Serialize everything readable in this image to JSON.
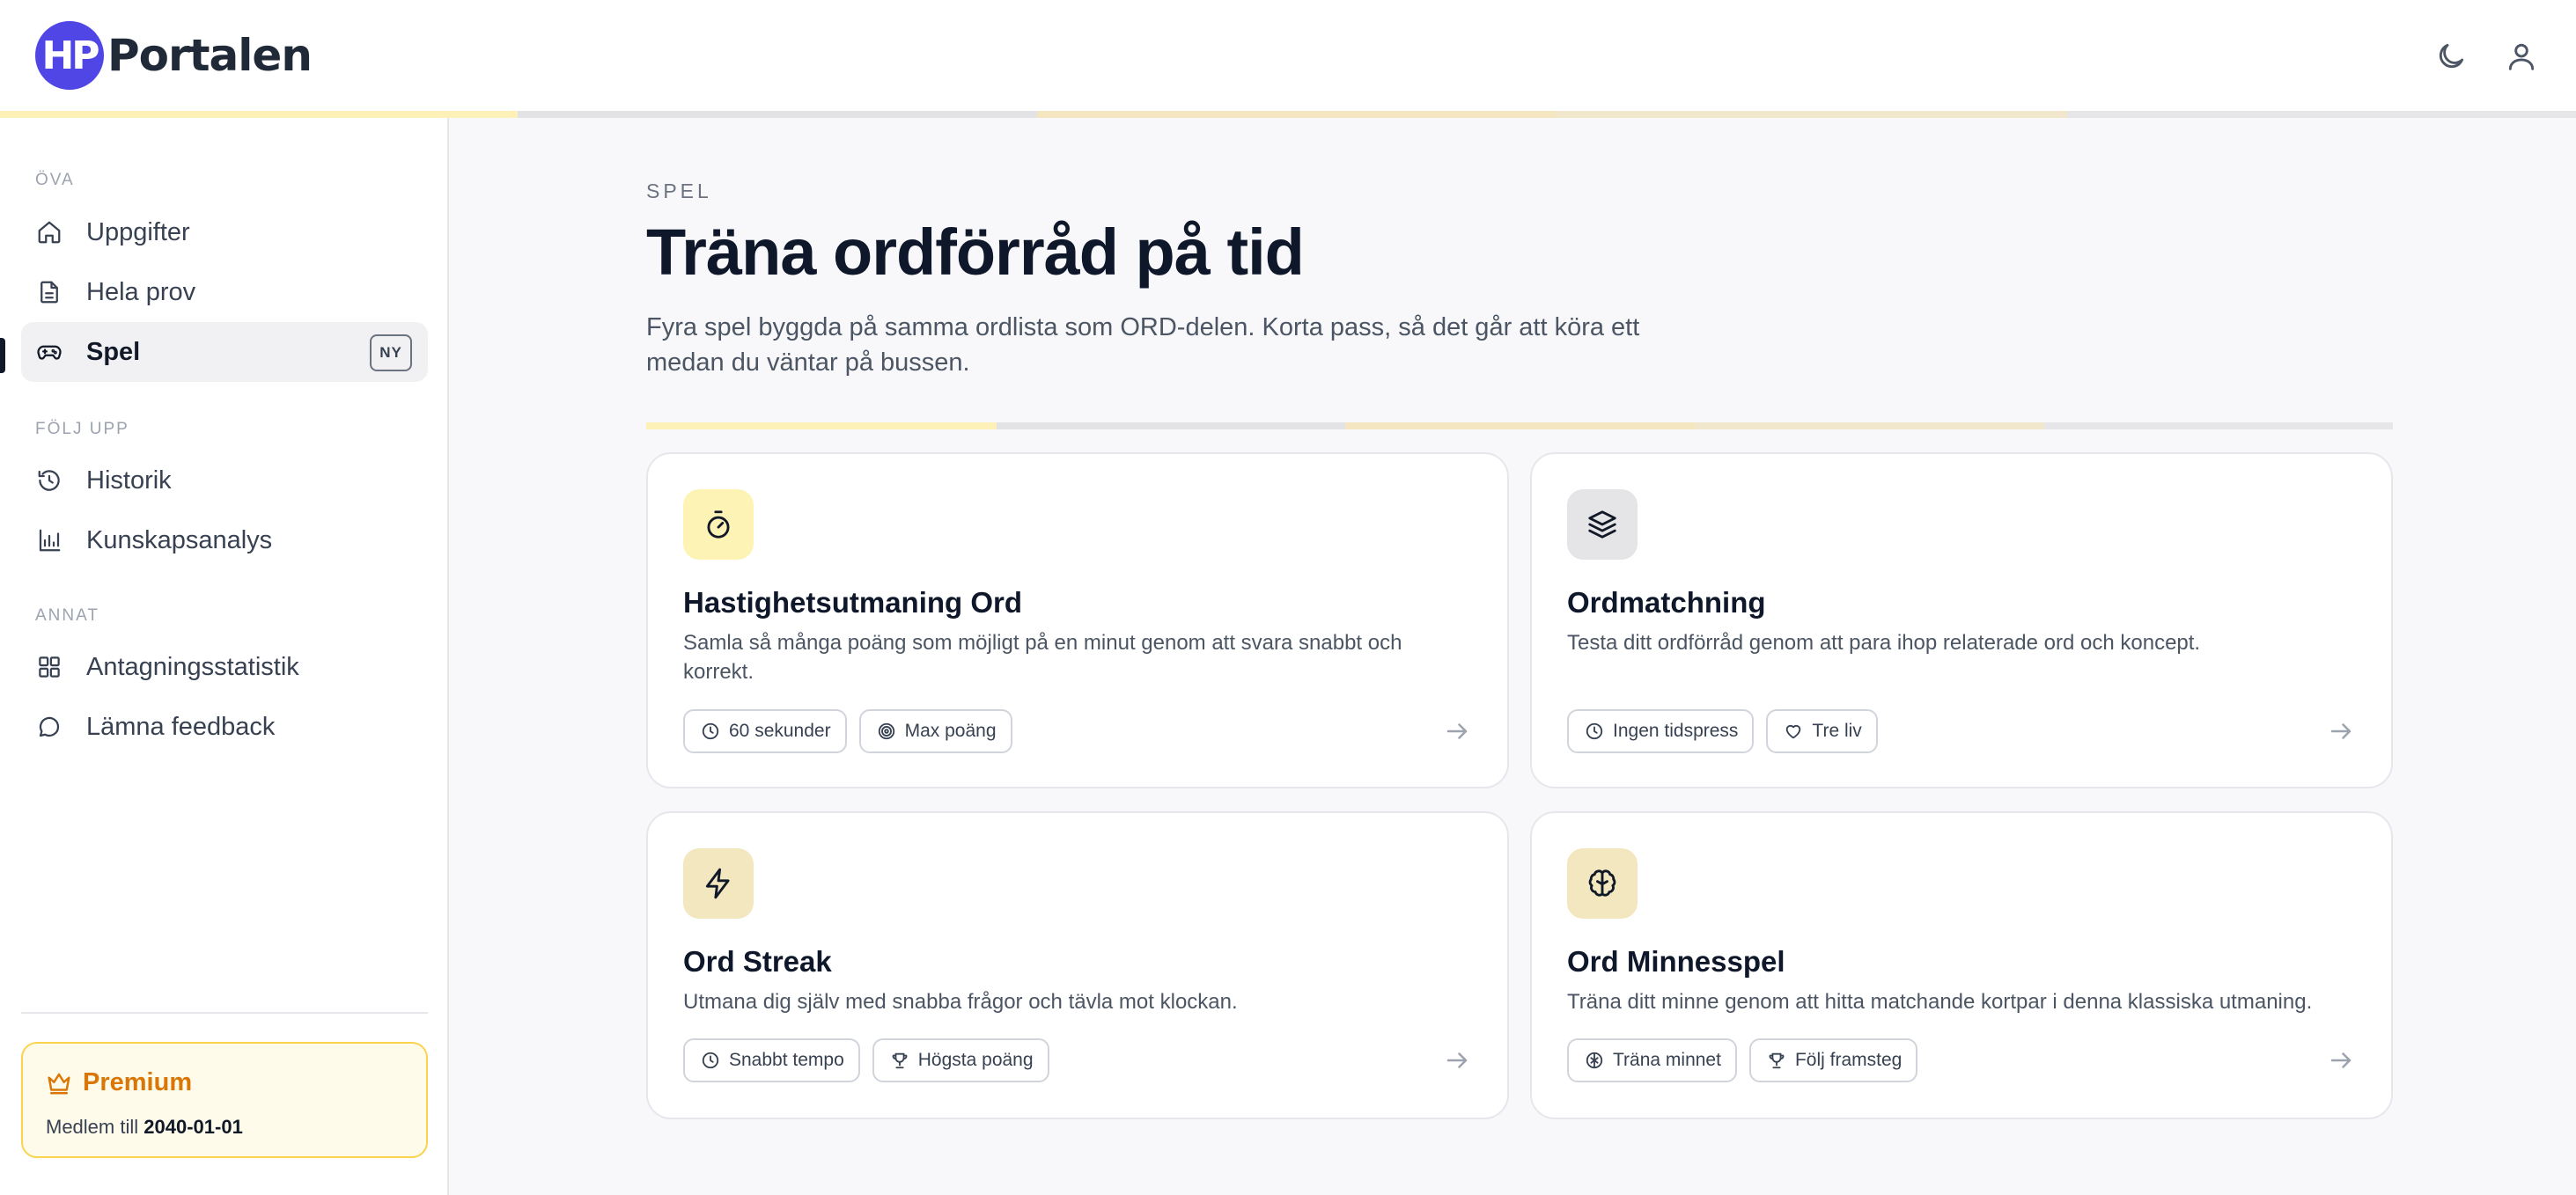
{
  "header": {
    "logo_mark": "HP",
    "logo_text": "Portalen",
    "theme_toggle_icon": "moon-icon",
    "account_icon": "user-icon"
  },
  "sidebar": {
    "sections": [
      {
        "label": "ÖVA"
      },
      {
        "label": "FÖLJ UPP"
      },
      {
        "label": "ANNAT"
      }
    ],
    "items": [
      {
        "label": "Uppgifter",
        "icon": "home-icon"
      },
      {
        "label": "Hela prov",
        "icon": "document-icon"
      },
      {
        "label": "Spel",
        "icon": "gamepad-icon",
        "active": true,
        "badge": "NY"
      },
      {
        "label": "Historik",
        "icon": "history-icon"
      },
      {
        "label": "Kunskapsanalys",
        "icon": "bar-chart-icon"
      },
      {
        "label": "Antagningsstatistik",
        "icon": "grid-icon"
      },
      {
        "label": "Lämna feedback",
        "icon": "chat-icon"
      }
    ],
    "premium": {
      "title": "Premium",
      "icon": "crown-icon",
      "member_prefix": "Medlem till",
      "member_until": "2040-01-01"
    }
  },
  "main": {
    "eyebrow": "SPEL",
    "title": "Träna ordförråd på tid",
    "intro": "Fyra spel byggda på samma ordlista som ORD-delen. Korta pass, så det går att köra ett medan du väntar på bussen.",
    "cards": [
      {
        "title": "Hastighetsutmaning Ord",
        "description": "Samla så många poäng som möjligt på en minut genom att svara snabbt och korrekt.",
        "icon": "stopwatch-icon",
        "icon_bg": "#fdf3b5",
        "chips": [
          {
            "label": "60 sekunder",
            "icon": "clock-icon"
          },
          {
            "label": "Max poäng",
            "icon": "target-icon"
          }
        ]
      },
      {
        "title": "Ordmatchning",
        "description": "Testa ditt ordförråd genom att para ihop relaterade ord och koncept.",
        "icon": "layers-icon",
        "icon_bg": "#e5e5e7",
        "chips": [
          {
            "label": "Ingen tidspress",
            "icon": "clock-icon"
          },
          {
            "label": "Tre liv",
            "icon": "heart-icon"
          }
        ]
      },
      {
        "title": "Ord Streak",
        "description": "Utmana dig själv med snabba frågor och tävla mot klockan.",
        "icon": "lightning-icon",
        "icon_bg": "#f3e7c0",
        "chips": [
          {
            "label": "Snabbt tempo",
            "icon": "clock-icon"
          },
          {
            "label": "Högsta poäng",
            "icon": "trophy-icon"
          }
        ]
      },
      {
        "title": "Ord Minnesspel",
        "description": "Träna ditt minne genom att hitta matchande kortpar i denna klassiska utmaning.",
        "icon": "brain-icon",
        "icon_bg": "#f3e7c0",
        "chips": [
          {
            "label": "Träna minnet",
            "icon": "brain-icon"
          },
          {
            "label": "Följ framsteg",
            "icon": "trophy-icon"
          }
        ]
      }
    ]
  },
  "colors": {
    "brand": "#4f46e5",
    "accent_yellow": "#fef3b5",
    "premium": "#d97706"
  }
}
